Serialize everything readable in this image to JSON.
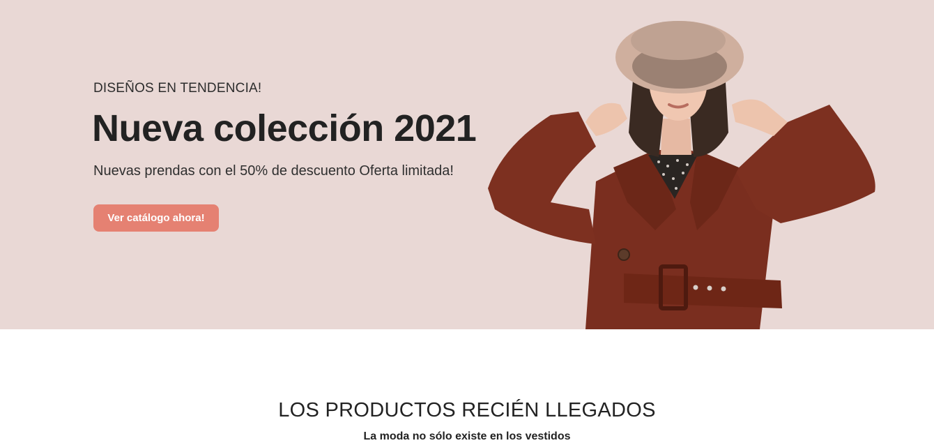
{
  "hero": {
    "eyebrow": "DISEÑOS EN TENDENCIA!",
    "title": "Nueva colección 2021",
    "subtitle": "Nuevas prendas con el 50% de descuento Oferta limitada!",
    "cta_label": "Ver catálogo ahora!",
    "image_icon": "fashion-model-photo"
  },
  "section": {
    "title": "LOS PRODUCTOS RECIÉN LLEGADOS",
    "subtitle": "La moda no sólo existe en los vestidos"
  },
  "colors": {
    "hero_background": "#e9d8d5",
    "accent": "#e58172",
    "coat": "#7a2e1f",
    "text": "#222222"
  }
}
